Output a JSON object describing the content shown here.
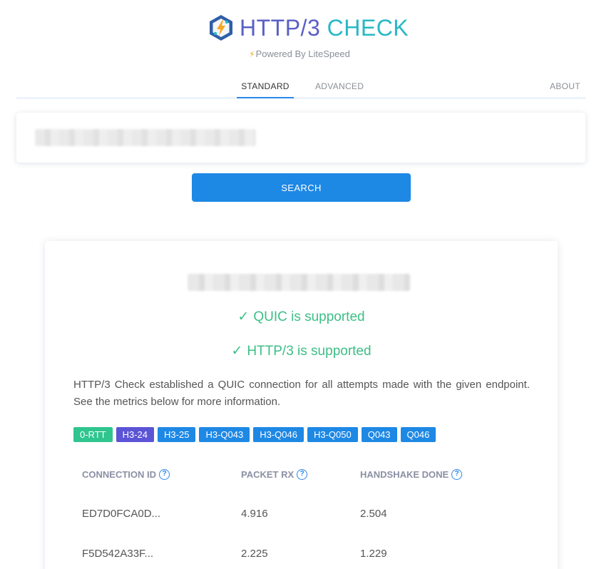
{
  "brand": {
    "title_part1": "HTTP/3",
    "title_part2": "CHECK",
    "powered_by": "Powered By LiteSpeed",
    "bolt_glyph": "⚡",
    "colors": {
      "http": "#5a5fc6",
      "check": "#27b8c6",
      "accent": "#1e88e5",
      "success": "#3dbf86"
    }
  },
  "tabs": {
    "standard": "STANDARD",
    "advanced": "ADVANCED",
    "about": "ABOUT"
  },
  "search": {
    "button_label": "SEARCH"
  },
  "result": {
    "quic_status": "QUIC is supported",
    "http3_status": "HTTP/3 is supported",
    "check_glyph": "✓",
    "description": "HTTP/3 Check established a QUIC connection for all attempts made with the given endpoint. See the metrics below for more information.",
    "badges": [
      {
        "label": "0-RTT",
        "color": "#2ec58e"
      },
      {
        "label": "H3-24",
        "color": "#5b54d6"
      },
      {
        "label": "H3-25",
        "color": "#1e88e5"
      },
      {
        "label": "H3-Q043",
        "color": "#1e88e5"
      },
      {
        "label": "H3-Q046",
        "color": "#1e88e5"
      },
      {
        "label": "H3-Q050",
        "color": "#1e88e5"
      },
      {
        "label": "Q043",
        "color": "#1e88e5"
      },
      {
        "label": "Q046",
        "color": "#1e88e5"
      }
    ],
    "metrics": {
      "headers": {
        "connection_id": "CONNECTION ID",
        "packet_rx": "PACKET RX",
        "handshake_done": "HANDSHAKE DONE",
        "help_glyph": "?"
      },
      "rows": [
        {
          "connection_id": "ED7D0FCA0D...",
          "packet_rx": "4.916",
          "handshake_done": "2.504"
        },
        {
          "connection_id": "F5D542A33F...",
          "packet_rx": "2.225",
          "handshake_done": "1.229"
        }
      ]
    }
  }
}
